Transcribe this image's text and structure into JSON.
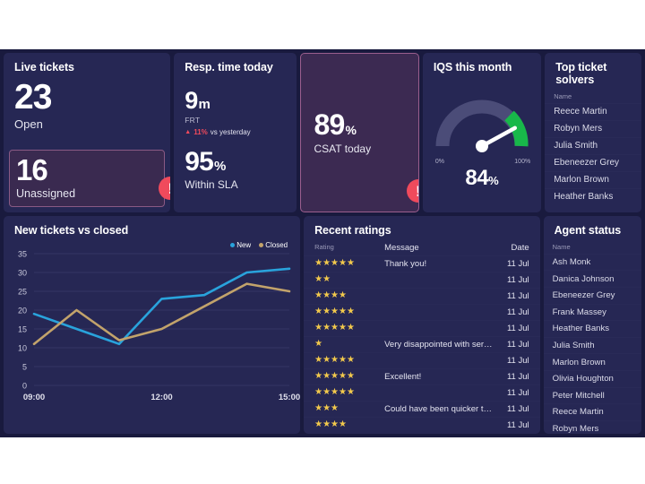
{
  "theme": {
    "page_bg": "#ffffff",
    "dashboard_bg": "#191A3E",
    "card_bg": "#262754",
    "highlight_card_bg": "#3C2A52",
    "highlight_border": "#9B5E8E",
    "alert_red": "#F04A5C",
    "series_new": "#29A3DC",
    "series_closed": "#C2A36B",
    "gauge_track": "#4B4C78",
    "gauge_green": "#18B84A",
    "star_gold": "#F2C94C"
  },
  "live_tickets": {
    "title": "Live tickets",
    "open_value": "23",
    "open_label": "Open",
    "unassigned_value": "16",
    "unassigned_label": "Unassigned",
    "alert_icon": "!"
  },
  "resp_time": {
    "title": "Resp. time today",
    "frt_value": "9",
    "frt_unit": "m",
    "frt_label": "FRT",
    "delta_arrow": "▲",
    "delta_value": "11%",
    "delta_label": "vs yesterday",
    "sla_value": "95",
    "sla_unit": "%",
    "sla_label": "Within SLA"
  },
  "csat": {
    "value": "89",
    "unit": "%",
    "label": "CSAT today",
    "alert_icon": "!"
  },
  "iqs": {
    "title": "IQS this month",
    "value": "84",
    "unit": "%",
    "min_label": "0%",
    "max_label": "100%"
  },
  "top_solvers": {
    "title": "Top ticket solvers",
    "column": "Name",
    "names": [
      "Reece Martin",
      "Robyn Mers",
      "Julia Smith",
      "Ebeneezer Grey",
      "Marlon Brown",
      "Heather Banks"
    ]
  },
  "agent_status": {
    "title": "Agent status",
    "column": "Name",
    "names": [
      "Ash Monk",
      "Danica Johnson",
      "Ebeneezer Grey",
      "Frank Massey",
      "Heather Banks",
      "Julia Smith",
      "Marlon Brown",
      "Olivia Houghton",
      "Peter Mitchell",
      "Reece Martin",
      "Robyn Mers"
    ]
  },
  "ratings": {
    "title": "Recent ratings",
    "columns": {
      "rating": "Rating",
      "message": "Message",
      "date": "Date"
    },
    "rows": [
      {
        "stars": 5,
        "message": "Thank you!",
        "date": "11 Jul"
      },
      {
        "stars": 2,
        "message": "",
        "date": "11 Jul"
      },
      {
        "stars": 4,
        "message": "",
        "date": "11 Jul"
      },
      {
        "stars": 5,
        "message": "",
        "date": "11 Jul"
      },
      {
        "stars": 5,
        "message": "",
        "date": "11 Jul"
      },
      {
        "stars": 1,
        "message": "Very disappointed with service",
        "date": "11 Jul"
      },
      {
        "stars": 5,
        "message": "",
        "date": "11 Jul"
      },
      {
        "stars": 5,
        "message": "Excellent!",
        "date": "11 Jul"
      },
      {
        "stars": 5,
        "message": "",
        "date": "11 Jul"
      },
      {
        "stars": 3,
        "message": "Could have been quicker to re...",
        "date": "11 Jul"
      },
      {
        "stars": 4,
        "message": "",
        "date": "11 Jul"
      }
    ]
  },
  "chart_data": {
    "type": "line",
    "title": "New tickets vs closed",
    "xlabel": "",
    "ylabel": "",
    "ylim": [
      0,
      35
    ],
    "yticks": [
      0,
      5,
      10,
      15,
      20,
      25,
      30,
      35
    ],
    "x": [
      "09:00",
      "10:00",
      "11:00",
      "12:00",
      "13:00",
      "14:00",
      "15:00"
    ],
    "xtick_labels": [
      "09:00",
      "12:00",
      "15:00"
    ],
    "grid": true,
    "legend_position": "top-right",
    "series": [
      {
        "name": "New",
        "color": "#29A3DC",
        "values": [
          19,
          15,
          11,
          23,
          24,
          30,
          31
        ]
      },
      {
        "name": "Closed",
        "color": "#C2A36B",
        "values": [
          11,
          20,
          12,
          15,
          21,
          27,
          25
        ]
      }
    ]
  }
}
